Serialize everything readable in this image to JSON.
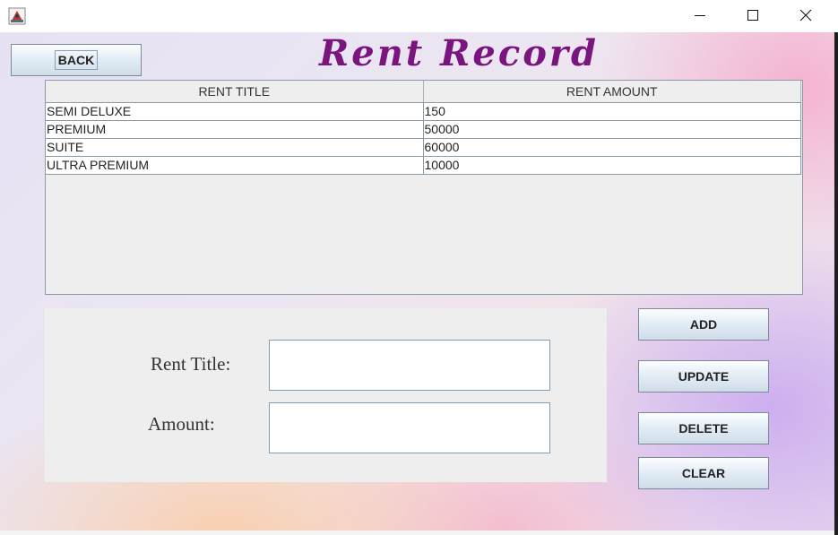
{
  "window": {
    "icon": "java-app-icon",
    "controls": {
      "minimize": "minimize-icon",
      "maximize": "maximize-icon",
      "close": "close-icon"
    }
  },
  "header": {
    "back_label": "BACK",
    "title": "Rent Record"
  },
  "table": {
    "columns": [
      "RENT TITLE",
      "RENT AMOUNT"
    ],
    "rows": [
      [
        "SEMI DELUXE",
        "150"
      ],
      [
        "PREMIUM",
        "50000"
      ],
      [
        "SUITE",
        "60000"
      ],
      [
        "ULTRA PREMIUM",
        "10000"
      ]
    ]
  },
  "form": {
    "title_label": "Rent Title:",
    "title_value": "",
    "amount_label": "Amount:",
    "amount_value": ""
  },
  "actions": {
    "add_label": "ADD",
    "update_label": "UPDATE",
    "delete_label": "DELETE",
    "clear_label": "CLEAR"
  },
  "colors": {
    "title": "#7a1580",
    "panel": "#eeeeee"
  }
}
